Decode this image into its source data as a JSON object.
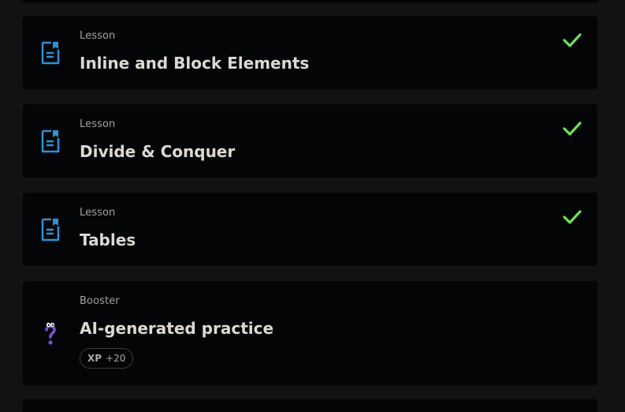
{
  "colors": {
    "page_background": "#111214",
    "card_background": "#040506",
    "lesson_icon": "#2f8fd8",
    "check": "#6ee05a",
    "booster_icon": "#7a4fd6",
    "title_text": "#dcd8d2",
    "type_text": "#a1a1a3"
  },
  "items": [
    {
      "type": "Lesson",
      "title": "Inline and Block Elements",
      "icon": "lesson-document-icon",
      "completed": true
    },
    {
      "type": "Lesson",
      "title": "Divide & Conquer",
      "icon": "lesson-document-icon",
      "completed": true
    },
    {
      "type": "Lesson",
      "title": "Tables",
      "icon": "lesson-document-icon",
      "completed": true
    },
    {
      "type": "Booster",
      "title": "AI-generated practice",
      "icon": "question-mark-icon",
      "completed": false,
      "xp_label": "XP",
      "xp_value": "+20"
    }
  ]
}
